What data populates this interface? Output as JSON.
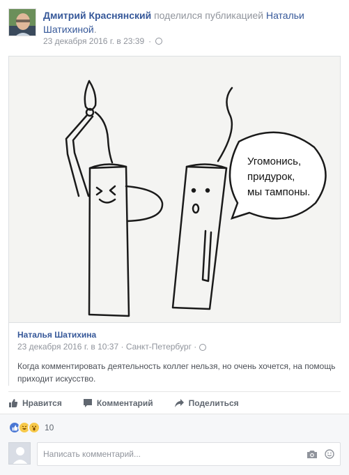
{
  "post": {
    "author": "Дмитрий Краснянский",
    "action_text": " поделился публикацией ",
    "shared_author": "Натальи Шатихиной",
    "period": ".",
    "timestamp": "23 декабря 2016 г. в 23:39",
    "separator": "·"
  },
  "image": {
    "speech_bubble": [
      "Угомонись,",
      "придурок,",
      "мы тампоны."
    ]
  },
  "shared": {
    "name": "Наталья Шатихина",
    "timestamp": "23 декабря 2016 г. в 10:37",
    "separator": "·",
    "location": "Санкт-Петербург",
    "separator2": "·",
    "text": "Когда комментировать деятельность коллег нельзя, но очень хочется, на помощь приходит искусство."
  },
  "actions": {
    "like": "Нравится",
    "comment": "Комментарий",
    "share": "Поделиться"
  },
  "reactions": {
    "count": "10",
    "icons": [
      "like-icon",
      "haha-icon",
      "wow-icon"
    ]
  },
  "comment": {
    "placeholder": "Написать комментарий..."
  },
  "colors": {
    "link": "#365899",
    "meta": "#90949c",
    "like_blue": "#4a77d4",
    "emoji_yellow": "#f7c94b"
  }
}
